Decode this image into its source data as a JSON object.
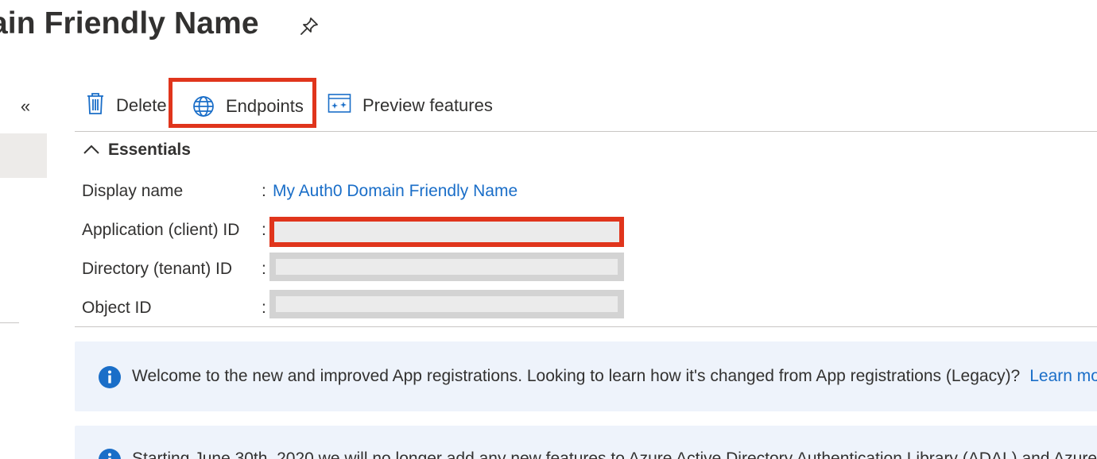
{
  "header": {
    "title": "ain Friendly Name",
    "pin_icon": "pin-icon"
  },
  "sidebar": {
    "collapse_label": "«"
  },
  "toolbar": {
    "delete_label": "Delete",
    "endpoints_label": "Endpoints",
    "preview_label": "Preview features",
    "highlight_color": "#e0351c"
  },
  "essentials": {
    "header_label": "Essentials",
    "rows": [
      {
        "label": "Display name",
        "colon": ":",
        "value": "My Auth0 Domain Friendly Name"
      },
      {
        "label": "Application (client) ID",
        "colon": ":",
        "value": ""
      },
      {
        "label": "Directory (tenant) ID",
        "colon": ":",
        "value": ""
      },
      {
        "label": "Object ID",
        "colon": ":",
        "value": ""
      }
    ]
  },
  "banners": [
    {
      "message": "Welcome to the new and improved App registrations. Looking to learn how it's changed from App registrations (Legacy)?",
      "link": "Learn mo"
    },
    {
      "message": "Starting June 30th, 2020 we will no longer add any new features to Azure Active Directory Authentication Library (ADAL) and Azure"
    }
  ],
  "colors": {
    "link": "#1a6ec8",
    "accent_red": "#e0351c",
    "banner_bg": "#eef3fb",
    "text": "#323130"
  }
}
